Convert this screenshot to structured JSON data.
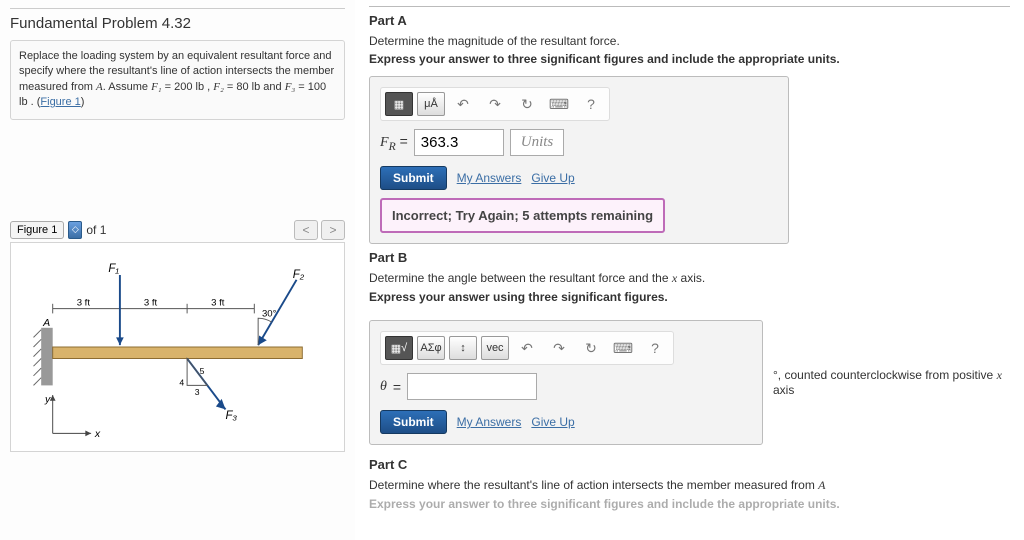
{
  "problem": {
    "number": "Fundamental Problem 4.32",
    "statement_1": "Replace the loading system by an equivalent resultant force and specify where the resultant's line of action intersects the member measured from ",
    "statement_A": "A",
    "statement_2": ". Assume ",
    "f1": "F₁",
    "eq": " = 200 lb , ",
    "f2": "F₂",
    "eq2": " = 80 lb and ",
    "f3": "F₃",
    "eq3": " = 100 lb . (",
    "figlink": "Figure 1",
    "close": ")"
  },
  "figure": {
    "select_label": "Figure 1",
    "of": "of 1",
    "prev": "<",
    "next": ">",
    "labels": {
      "F1": "F₁",
      "F2": "F₂",
      "F3": "F₃",
      "A": "A",
      "x": "x",
      "y": "y",
      "d": "3 ft",
      "ang": "30°",
      "t34": "3",
      "t45": "4",
      "t5": "5"
    }
  },
  "partA": {
    "title": "Part A",
    "desc": "Determine the magnitude of the resultant force.",
    "instr": "Express your answer to three significant figures and include the appropriate units.",
    "tool_mu": "μÅ",
    "var": "F",
    "sub": "R",
    "equals": " = ",
    "value": "363.3",
    "units_btn": "Units",
    "submit": "Submit",
    "my_answers": "My Answers",
    "give_up": "Give Up",
    "feedback": "Incorrect; Try Again; 5 attempts remaining",
    "undo": "↶",
    "redo": "↷",
    "reset": "↻",
    "kb": "⌨",
    "help": "?"
  },
  "partB": {
    "title": "Part B",
    "desc_1": "Determine the angle between the resultant force and the ",
    "desc_x": "x",
    "desc_2": " axis.",
    "instr": "Express your answer using three significant figures.",
    "tool_sqrt": "√",
    "tool_sigma": "ΑΣφ",
    "tool_arrows": "↕",
    "tool_vec": "vec",
    "var": "θ",
    "equals": " = ",
    "suffix_deg": "°",
    "suffix_1": ", counted counterclockwise from positive ",
    "suffix_x": "x",
    "suffix_2": " axis",
    "submit": "Submit",
    "my_answers": "My Answers",
    "give_up": "Give Up",
    "undo": "↶",
    "redo": "↷",
    "reset": "↻",
    "kb": "⌨",
    "help": "?"
  },
  "partC": {
    "title": "Part C",
    "desc_1": "Determine where the resultant's line of action intersects the member measured from ",
    "desc_A": "A",
    "instr": "Express your answer to three significant figures and include the appropriate units."
  }
}
